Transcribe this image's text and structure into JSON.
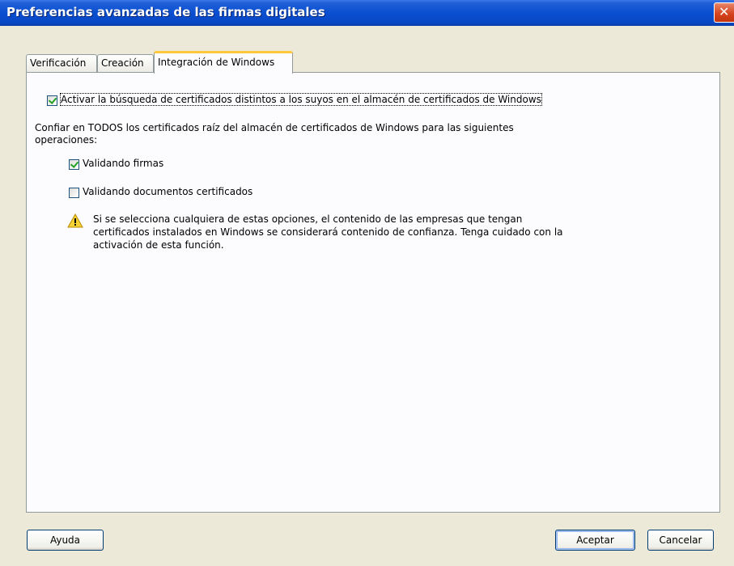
{
  "window": {
    "title": "Preferencias avanzadas de las firmas digitales",
    "close_glyph": "✕"
  },
  "tabs": [
    {
      "label": "Verificación",
      "active": false
    },
    {
      "label": "Creación",
      "active": false
    },
    {
      "label": "Integración de Windows",
      "active": true
    }
  ],
  "panel": {
    "enable_search": {
      "label": "Activar la búsqueda de certificados distintos a los suyos en el almacén de certificados de Windows",
      "checked": true
    },
    "trust_text_line1": "Confiar en TODOS los certificados raíz del almacén de certificados de Windows para las siguientes",
    "trust_text_line2": "operaciones:",
    "validate_signatures": {
      "label": "Validando firmas",
      "checked": true
    },
    "validate_certified_docs": {
      "label": "Validando documentos certificados",
      "checked": false
    },
    "warning": {
      "icon": "warning-icon",
      "line1": "Si se selecciona cualquiera de estas opciones, el contenido de las empresas que tengan",
      "line2": "certificados instalados en Windows se considerará contenido de confianza. Tenga cuidado con la",
      "line3": "activación de esta función."
    }
  },
  "buttons": {
    "help": "Ayuda",
    "accept": "Aceptar",
    "cancel": "Cancelar"
  }
}
